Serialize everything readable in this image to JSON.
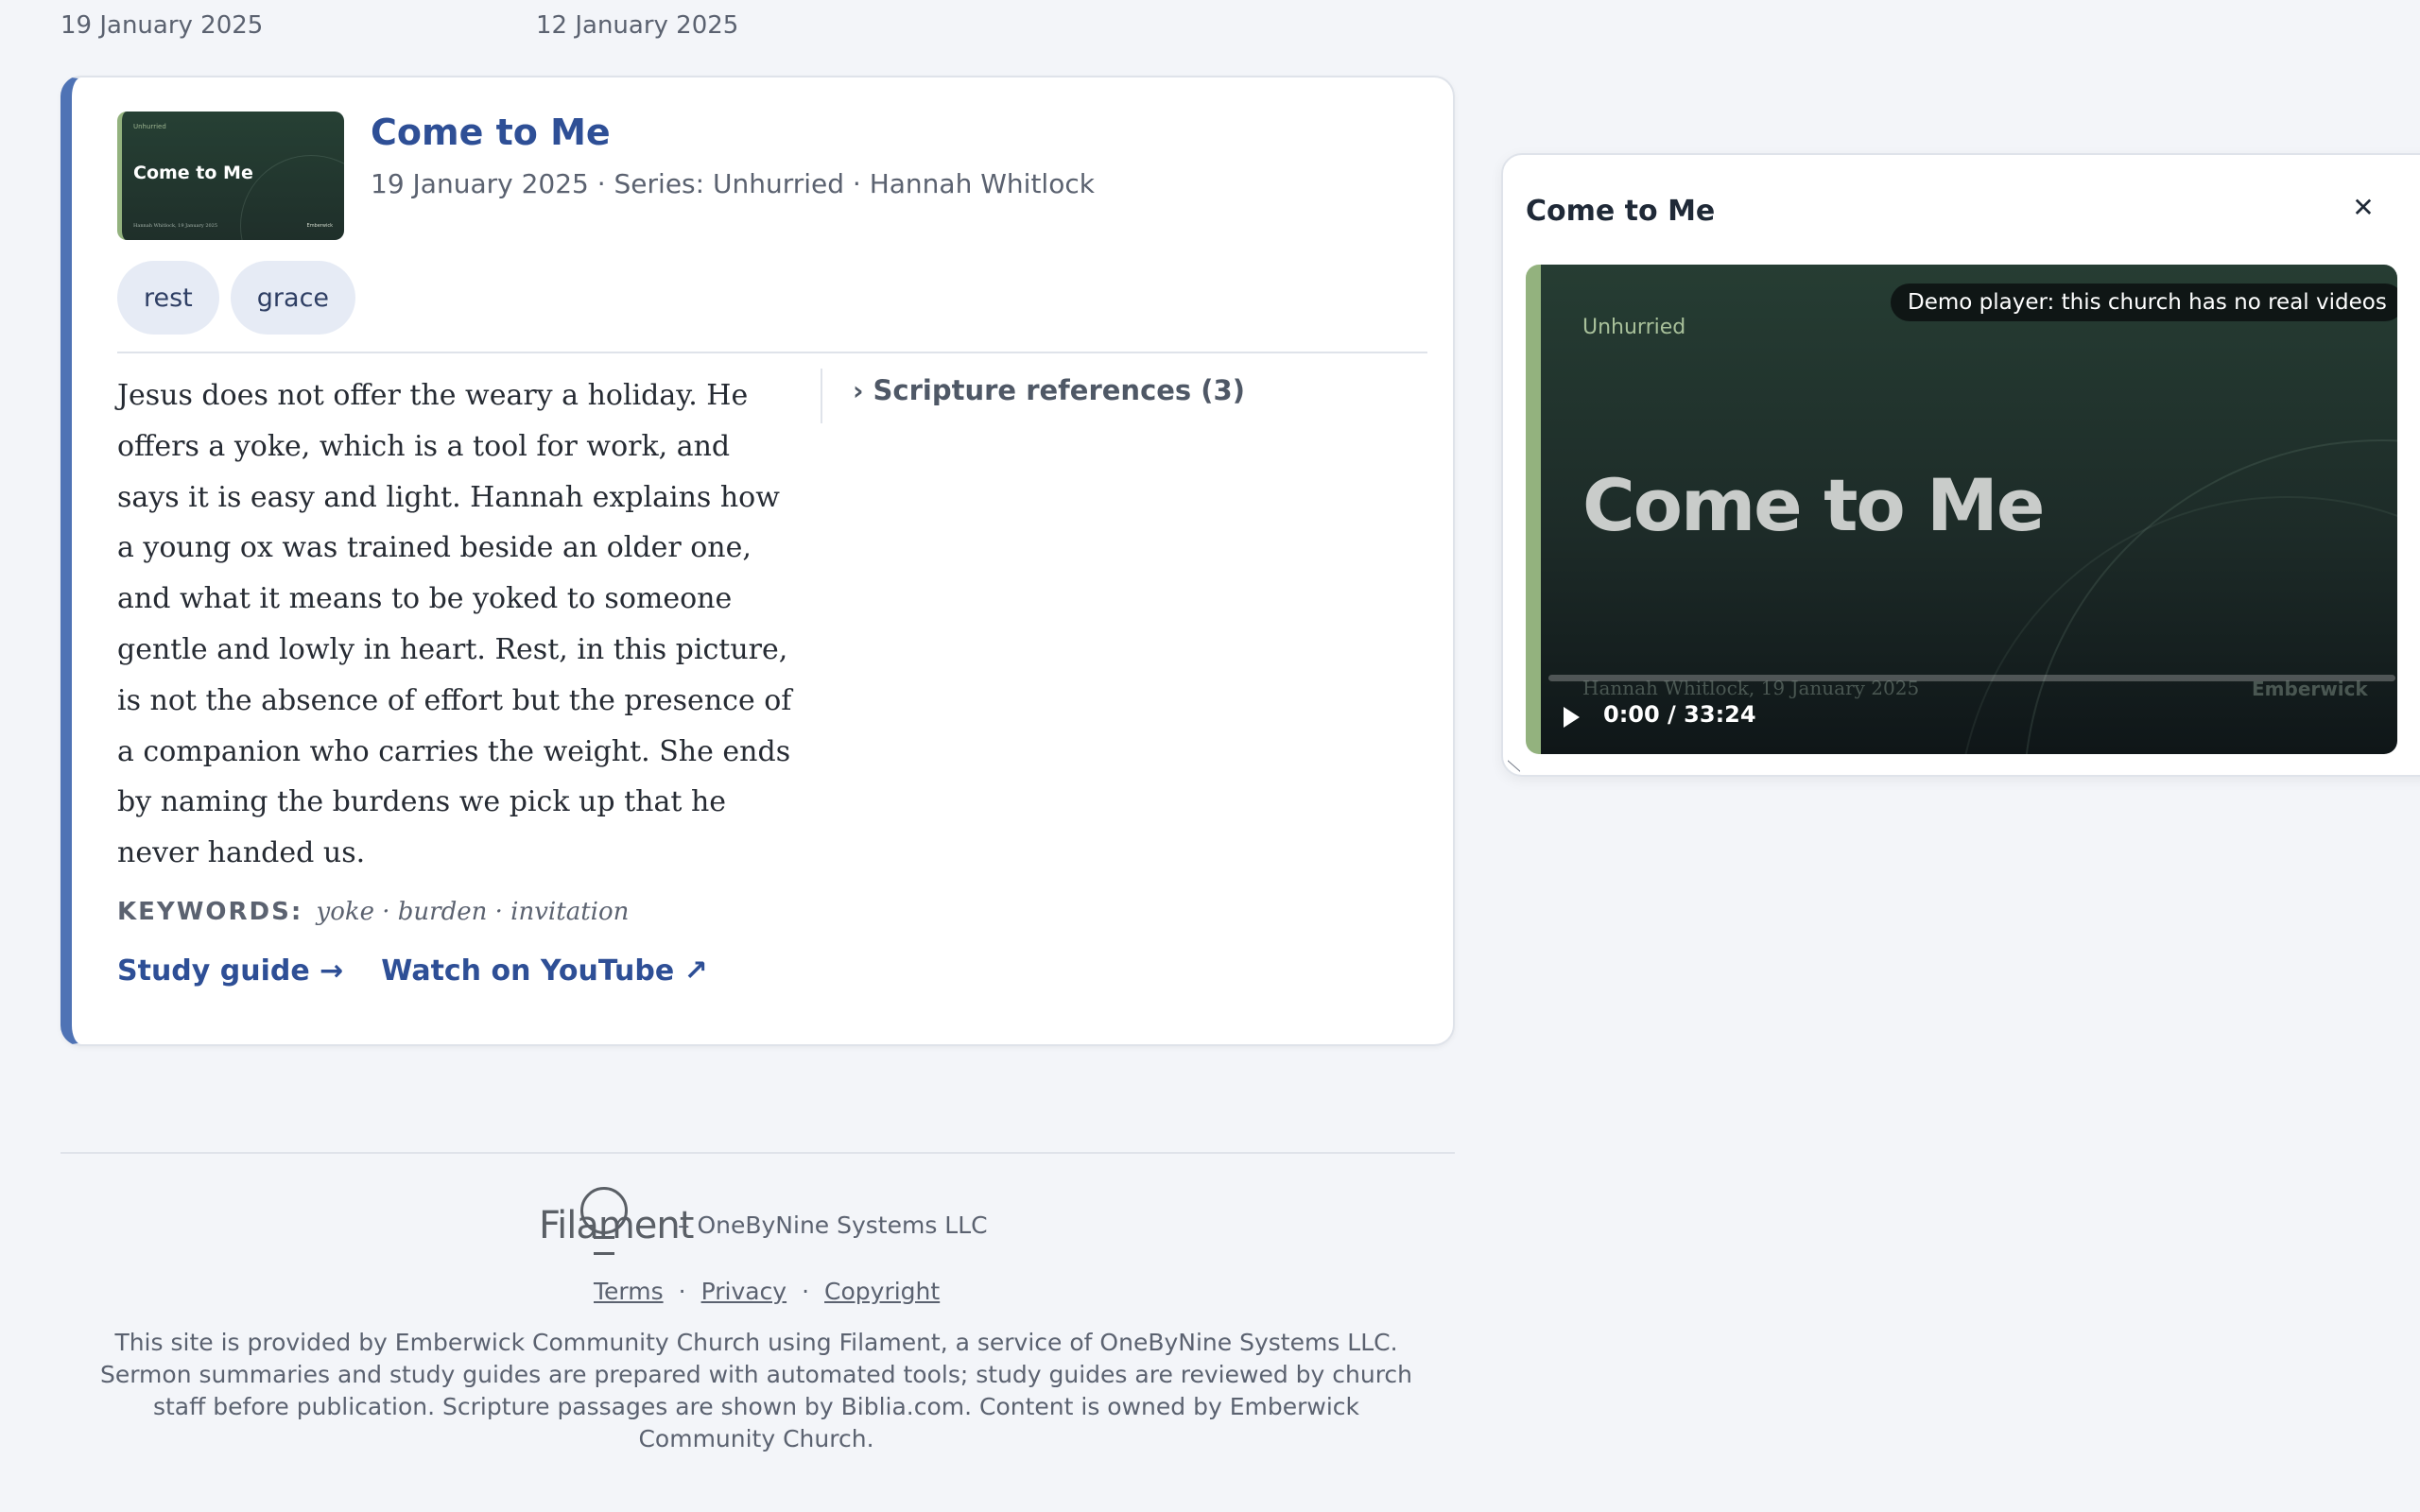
{
  "top_dates": [
    "19 January 2025",
    "12 January 2025"
  ],
  "sermon": {
    "thumbnail": {
      "series": "Unhurried",
      "title": "Come to Me",
      "byline": "Hannah Whitlock, 19 January 2025",
      "church": "Emberwick"
    },
    "title": "Come to Me",
    "meta": "19 January 2025 · Series: Unhurried · Hannah Whitlock",
    "tags": [
      "rest",
      "grace"
    ],
    "summary": "Jesus does not offer the weary a holiday. He offers a yoke, which is a tool for work, and says it is easy and light. Hannah explains how a young ox was trained beside an older one, and what it means to be yoked to someone gentle and lowly in heart. Rest, in this picture, is not the absence of effort but the presence of a companion who carries the weight. She ends by naming the burdens we pick up that he never handed us.",
    "scripture_toggle": "Scripture references (3)",
    "keywords_label": "KEYWORDS:",
    "keywords": "yoke · burden · invitation",
    "study_guide_link": "Study guide →",
    "youtube_link": "Watch on YouTube ↗"
  },
  "footer": {
    "logo_text": "Filament",
    "company": "–  OneByNine Systems LLC",
    "links": [
      "Terms",
      "Privacy",
      "Copyright"
    ],
    "separator": "·",
    "note": "This site is provided by Emberwick Community Church using Filament, a service of OneByNine Systems LLC. Sermon summaries and study guides are prepared with automated tools; study guides are reviewed by church staff before publication. Scripture passages are shown by Biblia.com. Content is owned by Emberwick Community Church."
  },
  "player": {
    "title": "Come to Me",
    "close_icon": "close-icon",
    "demo_badge": "Demo player: this church has no real videos",
    "video_series": "Unhurried",
    "video_title": "Come to Me",
    "video_byline": "Hannah Whitlock, 19 January 2025",
    "video_church": "Emberwick",
    "time": "0:00 / 33:24",
    "progress_fraction": 0,
    "accent": "#93b27e"
  },
  "colors": {
    "brand_blue": "#2e4f96",
    "card_accent": "#4f73b5",
    "page_bg": "#f3f5f9"
  }
}
